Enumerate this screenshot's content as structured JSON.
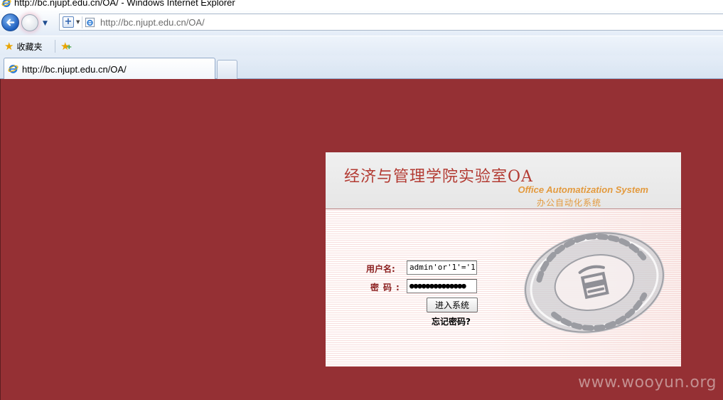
{
  "window": {
    "title": "http://bc.njupt.edu.cn/OA/ - Windows Internet Explorer"
  },
  "navbar": {
    "address": "http://bc.njupt.edu.cn/OA/"
  },
  "favorites_bar": {
    "favorites_label": "收藏夹"
  },
  "tabs": [
    {
      "label": "http://bc.njupt.edu.cn/OA/"
    }
  ],
  "login": {
    "title_cn": "经济与管理学院实验室OA",
    "title_en": "Office Automatization System",
    "subtitle_cn": "办公自动化系统",
    "username_label": "用户名:",
    "password_label_left": "密",
    "password_label_right": "码",
    "password_colon": ":",
    "username_value": "admin'or'1'='1",
    "password_value": "●●●●●●●●●●●●●●",
    "submit_label": "进入系统",
    "forgot_label": "忘记密码?"
  },
  "watermark": "www.wooyun.org",
  "colors": {
    "page_background": "#953034",
    "title_red": "#b33b33",
    "accent_orange": "#e39a3e",
    "label_red": "#8a1e1e"
  }
}
